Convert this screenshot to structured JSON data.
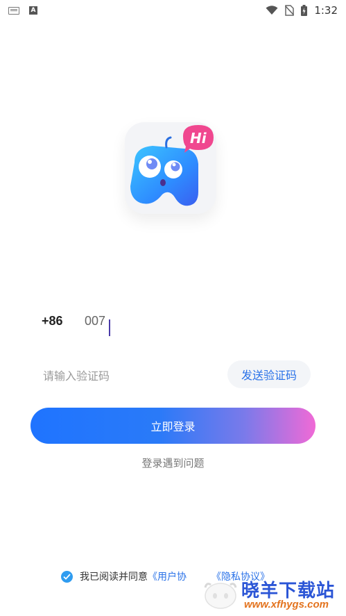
{
  "status_bar": {
    "time": "1:32",
    "left_icons": [
      "keyboard-icon",
      "a-icon"
    ],
    "a_letter": "A",
    "right_icons": [
      "wifi-icon",
      "no-sim-icon",
      "battery-icon"
    ]
  },
  "logo": {
    "bubble_text": "Hi",
    "colors": {
      "tile": "#f3f4f7",
      "bubble": "#f0478f",
      "mascot": "#2fa6ff"
    }
  },
  "phone": {
    "country_code": "+86",
    "value": "007"
  },
  "verification": {
    "placeholder": "请输入验证码",
    "send_button": "发送验证码"
  },
  "login_button": "立即登录",
  "problem_link": "登录遇到问题",
  "agreement": {
    "prefix": "我已阅读并同意",
    "user_agreement_visible": "《用户协",
    "privacy_policy_visible": "《隐私协议》",
    "checked": true
  },
  "watermark": {
    "cn": "晓羊下载站",
    "url": "www.xfhygs.com"
  },
  "colors": {
    "accent_blue": "#2a72e8",
    "gradient_start": "#1f74ff",
    "gradient_end": "#f06ad6",
    "check": "#2f9cf0"
  }
}
